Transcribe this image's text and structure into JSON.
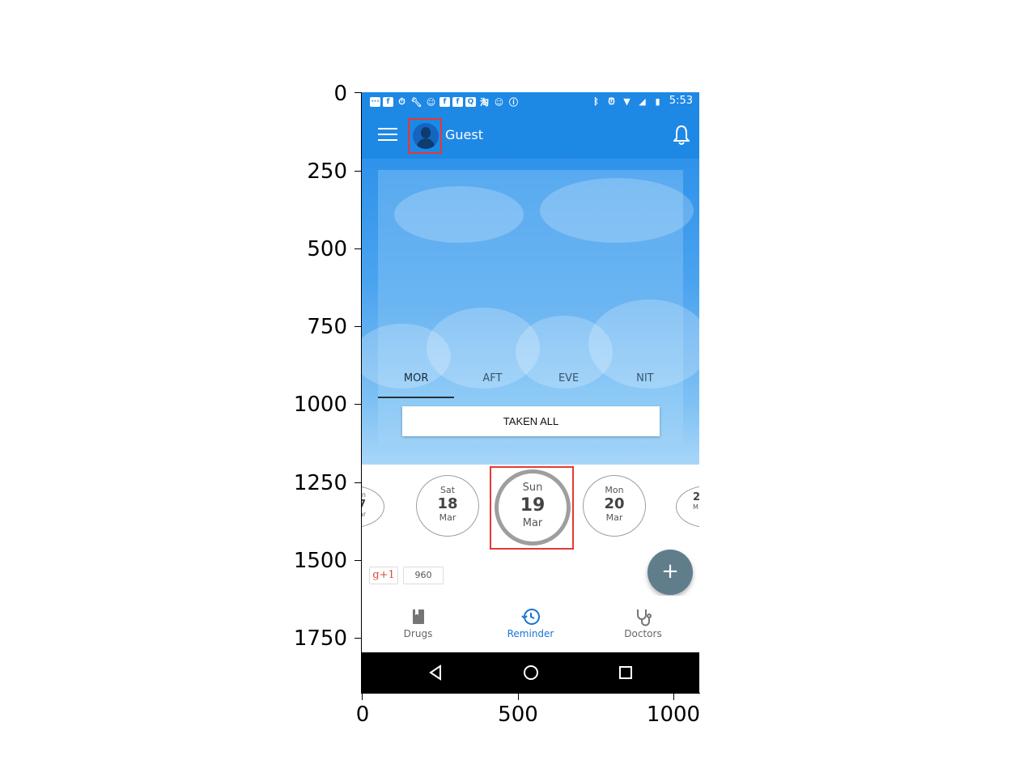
{
  "axes": {
    "y_ticks": [
      "0",
      "250",
      "500",
      "750",
      "1000",
      "1250",
      "1500",
      "1750"
    ],
    "x_ticks": [
      "0",
      "500",
      "1000"
    ]
  },
  "status_bar": {
    "time": "5:53",
    "icons": [
      "message-icon",
      "facebook-icon",
      "timer-icon",
      "wrench-icon",
      "smiley-icon",
      "facebook-icon",
      "facebook-icon",
      "qq-icon",
      "taobao-icon",
      "smiley-icon",
      "info-icon",
      "bluetooth-icon",
      "alarm-icon",
      "wifi-icon",
      "signal-icon",
      "battery-icon"
    ]
  },
  "app_bar": {
    "user_name": "Guest"
  },
  "tabs": [
    {
      "label": "MOR",
      "active": true
    },
    {
      "label": "AFT",
      "active": false
    },
    {
      "label": "EVE",
      "active": false
    },
    {
      "label": "NIT",
      "active": false
    }
  ],
  "taken_all_label": "TAKEN ALL",
  "dates": {
    "prev2": {
      "dow": "n",
      "num": "7",
      "mon": "ar"
    },
    "prev1": {
      "dow": "Sat",
      "num": "18",
      "mon": "Mar"
    },
    "selected": {
      "dow": "Sun",
      "num": "19",
      "mon": "Mar"
    },
    "next1": {
      "dow": "Mon",
      "num": "20",
      "mon": "Mar"
    },
    "next2": {
      "dow": "",
      "num": "2",
      "mon": "M"
    }
  },
  "gplus": {
    "label": "g+1",
    "count": "960"
  },
  "fab_label": "+",
  "bottom_nav": [
    {
      "label": "Drugs",
      "active": false
    },
    {
      "label": "Reminder",
      "active": true
    },
    {
      "label": "Doctors",
      "active": false
    }
  ],
  "colors": {
    "primary": "#1e88e5",
    "fab": "#607d8b",
    "highlight_box": "#e53935",
    "active_nav": "#1976d2"
  }
}
